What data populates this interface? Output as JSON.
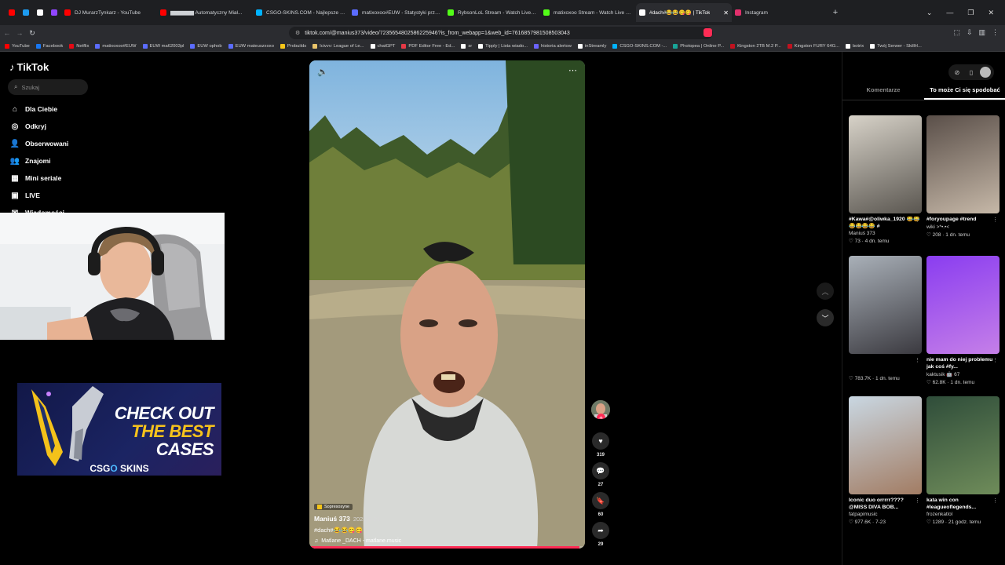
{
  "browser": {
    "tabs": [
      {
        "label": "",
        "color": "#ff0000",
        "pinned": true
      },
      {
        "label": "",
        "color": "#1d9bf0",
        "pinned": true
      },
      {
        "label": "",
        "color": "#ffffff",
        "pinned": true
      },
      {
        "label": "",
        "color": "#9146ff",
        "pinned": true
      },
      {
        "label": "DJ MurarzTynkarz - YouTube",
        "color": "#ff0000",
        "pinned": false
      },
      {
        "label": "▆▆▆▆▆▆ Automatyczny Miał...",
        "color": "#ff0000",
        "pinned": false
      },
      {
        "label": "CSGO-SKINS.COM - Najlepsze Skrzyn...",
        "color": "#00b3ff",
        "pinned": false
      },
      {
        "label": "matixoxoo#EUW - Statystyki przywo...",
        "color": "#5b6cff",
        "pinned": false
      },
      {
        "label": "RybsonLoL Stream - Watch Live on Ki...",
        "color": "#53fc18",
        "pinned": false
      },
      {
        "label": "matixoxoo Stream - Watch Live on Ki...",
        "color": "#53fc18",
        "pinned": false
      },
      {
        "label": "#dach#😂😂😋😋 | TikTok",
        "color": "#ffffff",
        "pinned": false,
        "active": true
      },
      {
        "label": "Instagram",
        "color": "#e1306c",
        "pinned": false
      }
    ],
    "url": "tiktok.com/@manius373/video/7235654802586225946?is_from_webapp=1&web_id=7616857981508503043",
    "bookmarks": [
      {
        "label": "YouTube",
        "color": "#ff0000"
      },
      {
        "label": "Facebook",
        "color": "#1877f2"
      },
      {
        "label": "Netflix",
        "color": "#e50914"
      },
      {
        "label": "matixoxoo#EUW",
        "color": "#5b6cff"
      },
      {
        "label": "EUW ma62003pl",
        "color": "#5b6cff"
      },
      {
        "label": "EUW ophob",
        "color": "#5b6cff"
      },
      {
        "label": "EUW mateuszxoxo",
        "color": "#5b6cff"
      },
      {
        "label": "Probuilds",
        "color": "#f5c518"
      },
      {
        "label": "Icivvv: League of Le...",
        "color": "#e9c46a"
      },
      {
        "label": "chatGPT",
        "color": "#ffffff"
      },
      {
        "label": "PDF Editor Free - Ed...",
        "color": "#e63946"
      },
      {
        "label": "sr",
        "color": "#ffffff"
      },
      {
        "label": "Tipply | Lista wiado...",
        "color": "#ffffff"
      },
      {
        "label": "historia alertow",
        "color": "#6c63ff"
      },
      {
        "label": "inStreamly",
        "color": "#ffffff"
      },
      {
        "label": "CSGO-SKINS.COM -...",
        "color": "#00b3ff"
      },
      {
        "label": "Photopea | Online P...",
        "color": "#18a497"
      },
      {
        "label": "Kingston 2TB M.2 P...",
        "color": "#c1121f"
      },
      {
        "label": "Kingston FURY 64G...",
        "color": "#c1121f"
      },
      {
        "label": "botrix",
        "color": "#ffffff"
      },
      {
        "label": "Twój Serwer - SkillH...",
        "color": "#ffffff"
      }
    ]
  },
  "sidebar": {
    "logo": "TikTok",
    "search_placeholder": "Szukaj",
    "items": [
      {
        "label": "Dla Ciebie",
        "icon": "compass-icon"
      },
      {
        "label": "Odkryj",
        "icon": "explore-icon"
      },
      {
        "label": "Obserwowani",
        "icon": "following-icon"
      },
      {
        "label": "Znajomi",
        "icon": "friends-icon"
      },
      {
        "label": "Mini seriale",
        "icon": "series-icon"
      },
      {
        "label": "LIVE",
        "icon": "live-icon"
      },
      {
        "label": "Wiadomości",
        "icon": "messages-icon"
      }
    ]
  },
  "ad": {
    "line1": "CHECK OUT",
    "line2": "THE BEST",
    "line3": "CASES",
    "brand_left": "CSG",
    "brand_o": "O",
    "brand_right": " SKINS"
  },
  "video": {
    "badge": "Sopresosyne",
    "author": "Maniuś 373",
    "date": "2023-5-21",
    "caption": "#dach#😂😂😋😋",
    "music": "Matlane _DACH - matlane.music",
    "progress": 0.98,
    "likes": "319",
    "comments": "27",
    "saves": "60",
    "shares": "29"
  },
  "right_panel": {
    "tabs": [
      {
        "label": "Komentarze",
        "active": false
      },
      {
        "label": "To może Ci się spodobać",
        "active": true
      }
    ],
    "cards": [
      {
        "title": "#Kawa#@oliwka_1920 😂😂😂😂😂😂 #",
        "author": "Maniuś 373",
        "likes": "73",
        "time": "4 dn. temu",
        "colors": [
          "#d7d2c8",
          "#5a5650"
        ]
      },
      {
        "title": "#foryoupage #trend",
        "author": "wiki >*•.•<",
        "likes": "208",
        "time": "1 dn. temu",
        "colors": [
          "#5a4f49",
          "#c6b8a8"
        ]
      },
      {
        "title": "",
        "author": "",
        "likes": "783.7K",
        "time": "1 dn. temu",
        "colors": [
          "#a9b0b8",
          "#3b3a40"
        ]
      },
      {
        "title": "nie mam do niej problemu jak coś #fy...",
        "author": "kaktusik 🤖 67",
        "likes": "62.8K",
        "time": "1 dn. temu",
        "colors": [
          "#8a3df0",
          "#c57fe8"
        ]
      },
      {
        "title": "Iconic duo orrrrr???? @MISS DIVA BOB...",
        "author": "fatpapimusic",
        "likes": "977.6K",
        "time": "7-23",
        "colors": [
          "#c9d7e2",
          "#a27c63"
        ]
      },
      {
        "title": "kata win con #leagueoflegends...",
        "author": "frozenkatlol",
        "likes": "1289",
        "time": "21 godz. temu",
        "colors": [
          "#2f4d3a",
          "#6f8c5a"
        ]
      }
    ]
  }
}
